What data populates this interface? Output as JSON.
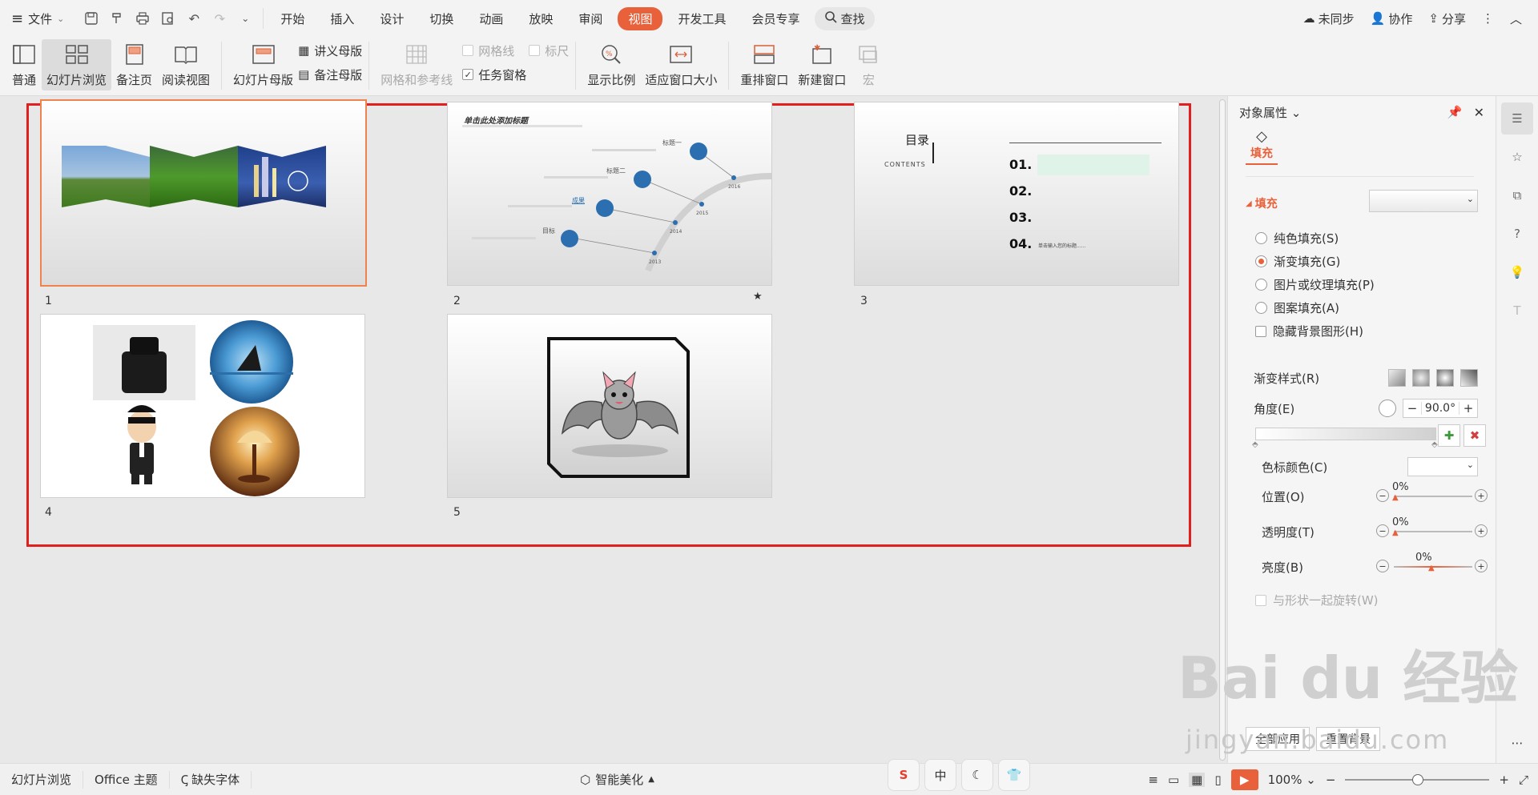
{
  "menu": {
    "file": "文件"
  },
  "tabs": [
    "开始",
    "插入",
    "设计",
    "切换",
    "动画",
    "放映",
    "审阅",
    "视图",
    "开发工具",
    "会员专享"
  ],
  "search_label": "查找",
  "top_right": {
    "sync": "未同步",
    "collab": "协作",
    "share": "分享"
  },
  "ribbon": {
    "normal": "普通",
    "slide_sorter": "幻灯片浏览",
    "notes_page": "备注页",
    "reading_view": "阅读视图",
    "slide_master": "幻灯片母版",
    "handout_master": "讲义母版",
    "notes_master": "备注母版",
    "grid_guides": "网格和参考线",
    "gridlines": "网格线",
    "ruler": "标尺",
    "task_pane": "任务窗格",
    "zoom": "显示比例",
    "fit_window": "适应窗口大小",
    "arrange": "重排窗口",
    "new_window": "新建窗口",
    "macro": "宏"
  },
  "slides": {
    "s1": "1",
    "s2": "2",
    "s3": "3",
    "s4": "4",
    "s5": "5",
    "s2_title": "单击此处添加标题",
    "s2_labels": [
      "标题一",
      "标题二",
      "成果",
      "目标"
    ],
    "s2_years": [
      "2016",
      "2015",
      "2014",
      "2013"
    ],
    "s3_title": "目录",
    "s3_sub": "CONTENTS",
    "s3_nums": [
      "01.",
      "02.",
      "03.",
      "04."
    ],
    "s3_last": "单击输入您的标题......"
  },
  "panel": {
    "title": "对象属性",
    "tab_fill": "填充",
    "section_fill": "填充",
    "options": [
      "纯色填充(S)",
      "渐变填充(G)",
      "图片或纹理填充(P)",
      "图案填充(A)"
    ],
    "hide_bg": "隐藏背景图形(H)",
    "gradient_style": "渐变样式(R)",
    "angle_label": "角度(E)",
    "angle_value": "90.0°",
    "stop_color": "色标颜色(C)",
    "position": "位置(O)",
    "position_val": "0%",
    "transparency": "透明度(T)",
    "transparency_val": "0%",
    "brightness": "亮度(B)",
    "brightness_val": "0%",
    "rotate_with_shape": "与形状一起旋转(W)",
    "apply_all": "全部应用",
    "reset": "重置背景"
  },
  "status": {
    "view": "幻灯片浏览",
    "theme": "Office 主题",
    "missing_font": "缺失字体",
    "beautify": "智能美化",
    "zoom": "100%"
  },
  "ime": [
    "S",
    "中"
  ],
  "watermark": {
    "logo": "Bai du 经验",
    "url": "jingyan.baidu.com"
  }
}
